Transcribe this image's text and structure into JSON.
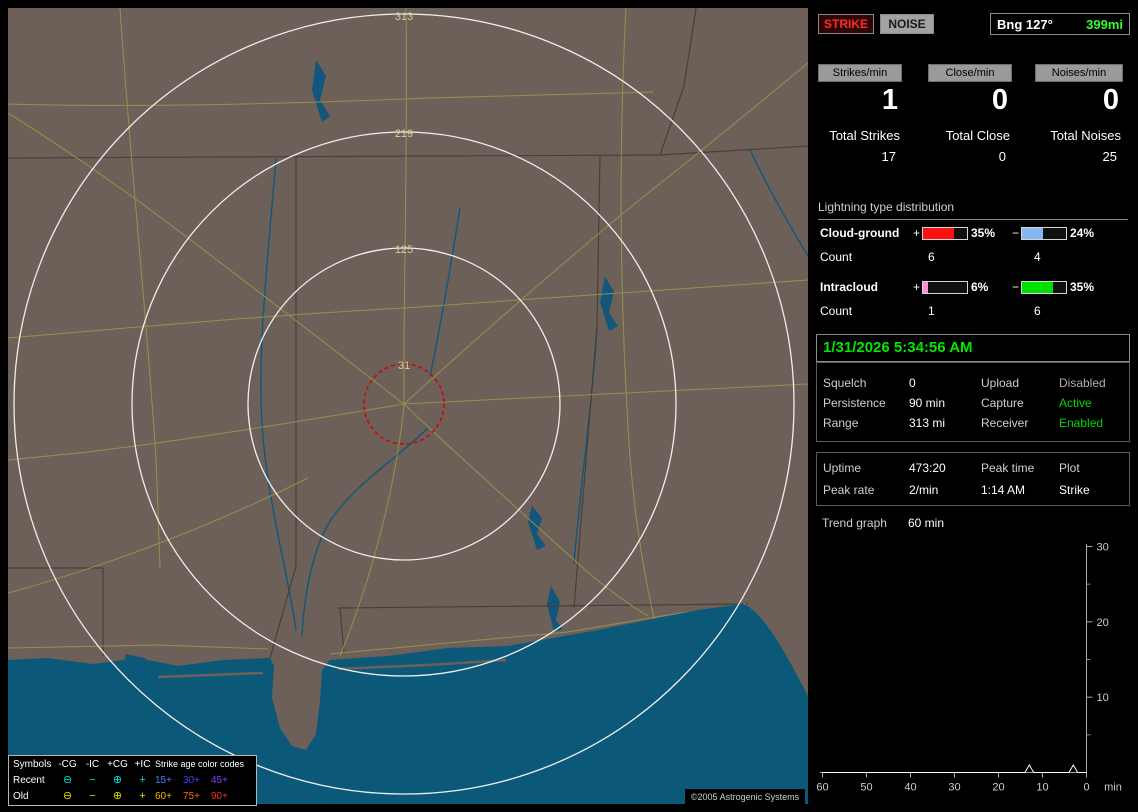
{
  "map": {
    "range_ring_labels": [
      "313",
      "219",
      "125",
      "31"
    ],
    "copyright": "©2005 Astrogenic Systems",
    "legend": {
      "symbols_header": "Symbols",
      "symbol_cols": [
        "-CG",
        "-IC",
        "+CG",
        "+IC"
      ],
      "age_header": "Strike age color codes",
      "recent": {
        "label": "Recent",
        "glyphs": [
          "⊖",
          "−",
          "⊕",
          "+"
        ],
        "ages": [
          "15+",
          "30+",
          "45+"
        ]
      },
      "old": {
        "label": "Old",
        "glyphs": [
          "⊖",
          "−",
          "⊕",
          "+"
        ],
        "ages": [
          "60+",
          "75+",
          "90+"
        ]
      },
      "colors": {
        "recent": "#00dcdc",
        "old": "#dcdc00",
        "age_recent": [
          "#4d7dff",
          "#4040ff",
          "#8040ff"
        ],
        "age_old": [
          "#ffb300",
          "#ff7000",
          "#ff3020"
        ]
      }
    }
  },
  "panel": {
    "mode_buttons": {
      "strike": "STRIKE",
      "noise": "NOISE"
    },
    "bearing": {
      "label": "Bng 127°",
      "range": "399mi"
    },
    "rate_columns": [
      {
        "header": "Strikes/min",
        "rate": "1",
        "total_label": "Total Strikes",
        "total": "17"
      },
      {
        "header": "Close/min",
        "rate": "0",
        "total_label": "Total Close",
        "total": "0"
      },
      {
        "header": "Noises/min",
        "rate": "0",
        "total_label": "Total Noises",
        "total": "25"
      }
    ],
    "distribution": {
      "title": "Lightning type distribution",
      "plus_symbol": "+",
      "minus_symbol": "−",
      "rows": [
        {
          "label": "Cloud-ground",
          "plus_pct": 35,
          "plus_pct_text": "35%",
          "plus_color": "#ff1010",
          "minus_pct": 24,
          "minus_pct_text": "24%",
          "minus_color": "#85b8f0",
          "count_label": "Count",
          "plus_count": "6",
          "minus_count": "4"
        },
        {
          "label": "Intracloud",
          "plus_pct": 6,
          "plus_pct_text": "6%",
          "plus_color": "#ff8fd0",
          "minus_pct": 35,
          "minus_pct_text": "35%",
          "minus_color": "#00e000",
          "count_label": "Count",
          "plus_count": "1",
          "minus_count": "6"
        }
      ]
    },
    "datetime": "1/31/2026 5:34:56 AM",
    "status": {
      "rows": [
        {
          "l1": "Squelch",
          "v1": "0",
          "l2": "Upload",
          "v2": "Disabled",
          "v2_color": "#b0b0b0"
        },
        {
          "l1": "Persistence",
          "v1": "90 min",
          "l2": "Capture",
          "v2": "Active",
          "v2_color": "#00d800"
        },
        {
          "l1": "Range",
          "v1": "313 mi",
          "l2": "Receiver",
          "v2": "Enabled",
          "v2_color": "#00d800"
        }
      ]
    },
    "uptime_box": {
      "row1": [
        "Uptime",
        "473:20",
        "Peak time",
        "Plot"
      ],
      "row2": [
        "Peak rate",
        "2/min",
        "1:14 AM",
        "Strike"
      ]
    }
  },
  "chart_data": {
    "type": "line",
    "title": "Trend graph",
    "window": "60 min",
    "series": [
      {
        "name": "Strike",
        "baseline_count": 0,
        "points": [
          {
            "min_ago": 13,
            "count": 1
          },
          {
            "min_ago": 3,
            "count": 1
          }
        ]
      }
    ],
    "x_axis": {
      "label": "min",
      "ticks": [
        60,
        50,
        40,
        30,
        20,
        10,
        0
      ],
      "range_min_ago": [
        60,
        0
      ]
    },
    "y_axis": {
      "ticks": [
        10,
        20,
        30
      ],
      "minor_ticks": [
        5,
        15,
        25
      ],
      "range": [
        0,
        30
      ]
    },
    "grid": false,
    "legend_position": "none"
  }
}
